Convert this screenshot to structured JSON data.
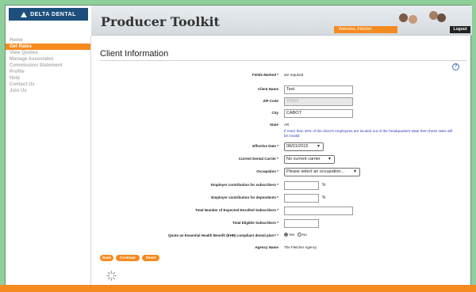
{
  "brand": {
    "logo_text": "DELTA DENTAL",
    "accent": "#f58a1f",
    "nav_blue": "#1c4f7c"
  },
  "header": {
    "title": "Producer Toolkit",
    "welcome": "Welcome, Fletcher",
    "logout": "Logout"
  },
  "sidebar": {
    "items": [
      {
        "label": "Home"
      },
      {
        "label": "Get Rates"
      },
      {
        "label": "View Quotes"
      },
      {
        "label": "Manage Associates"
      },
      {
        "label": "Commission Statement"
      },
      {
        "label": "Profile"
      },
      {
        "label": "Help"
      },
      {
        "label": "Contact Us"
      },
      {
        "label": "Join Us"
      }
    ],
    "active_index": 1
  },
  "main": {
    "title": "Client Information",
    "help_icon": "?",
    "form": {
      "fields_marked_label": "Fields Marked *",
      "fields_marked_value": "are required",
      "client_name_label": "Client Name",
      "client_name_value": "Test",
      "zip_label": "ZIP Code",
      "zip_value": "72023",
      "city_label": "City",
      "city_value": "CABOT",
      "state_label": "State",
      "state_value": "AR",
      "state_note": "If more than 25% of the client's employees are located out of the headquarters state then these rates will be invalid",
      "effective_date_label": "Effective Date *",
      "effective_date_value": "08/01/2015",
      "carrier_label": "Current Dental Carrier *",
      "carrier_value": "No current carrier",
      "occupation_label": "Occupation *",
      "occupation_value": "Please select an occupation...",
      "emp_sub_label": "Employer contribution for subscribers *",
      "emp_dep_label": "Employer contribution for dependents *",
      "percent": "%",
      "expected_label": "Total Number of Expected Enrolled Subscribers *",
      "eligible_label": "Total Eligible Subscribers *",
      "ehb_label": "Quote an Essential Health Benefit (EHB) compliant dental plan? *",
      "ehb_yes": "Yes",
      "ehb_no": "No",
      "agency_label": "Agency Name",
      "agency_value": "The Fletcher Agency"
    },
    "buttons": {
      "back": "Back",
      "continue": "Continue",
      "reset": "Reset"
    }
  }
}
